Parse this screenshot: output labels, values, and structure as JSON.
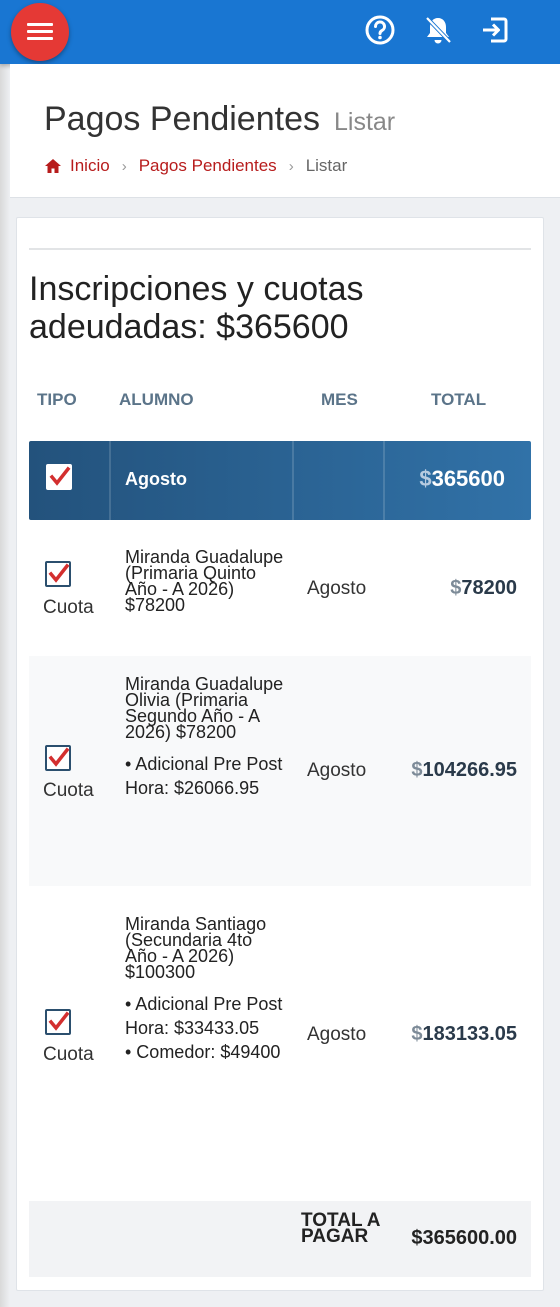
{
  "topbar": {
    "menu_icon": "hamburger-menu-icon",
    "help_icon": "help-circle-icon",
    "notifications_icon": "bell-off-icon",
    "logout_icon": "logout-icon"
  },
  "header": {
    "title": "Pagos Pendientes",
    "subtitle": "Listar",
    "breadcrumb": {
      "home": "Inicio",
      "section": "Pagos Pendientes",
      "current": "Listar"
    }
  },
  "card": {
    "title": "Inscripciones y cuotas adeudadas: $365600",
    "columns": {
      "tipo": "TIPO",
      "alumno": "ALUMNO",
      "mes": "MES",
      "total": "TOTAL"
    },
    "group": {
      "checked": true,
      "month": "Agosto",
      "currency": "$",
      "total": "365600"
    },
    "rows": [
      {
        "checked": true,
        "tipo": "Cuota",
        "alumno": "Miranda Guadalupe (Primaria Quinto Año - A 2026) $78200",
        "extras": [],
        "mes": "Agosto",
        "currency": "$",
        "total": "78200"
      },
      {
        "checked": true,
        "tipo": "Cuota",
        "alumno": "Miranda Guadalupe Olivia (Primaria Segundo Año - A 2026) $78200",
        "extras": [
          "• Adicional Pre Post Hora: $26066.95"
        ],
        "mes": "Agosto",
        "currency": "$",
        "total": "104266.95"
      },
      {
        "checked": true,
        "tipo": "Cuota",
        "alumno": "Miranda Santiago (Secundaria 4to Año - A 2026) $100300",
        "extras": [
          "• Adicional Pre Post Hora: $33433.05",
          "• Comedor: $49400"
        ],
        "mes": "Agosto",
        "currency": "$",
        "total": "183133.05"
      }
    ],
    "footer": {
      "label": "TOTAL A PAGAR",
      "total": "$365600.00"
    }
  },
  "colors": {
    "topbar": "#1976d2",
    "menu_button": "#e53935",
    "breadcrumb_link": "#b71c1c",
    "group_row": "#23527c",
    "check": "#d32f2f"
  }
}
